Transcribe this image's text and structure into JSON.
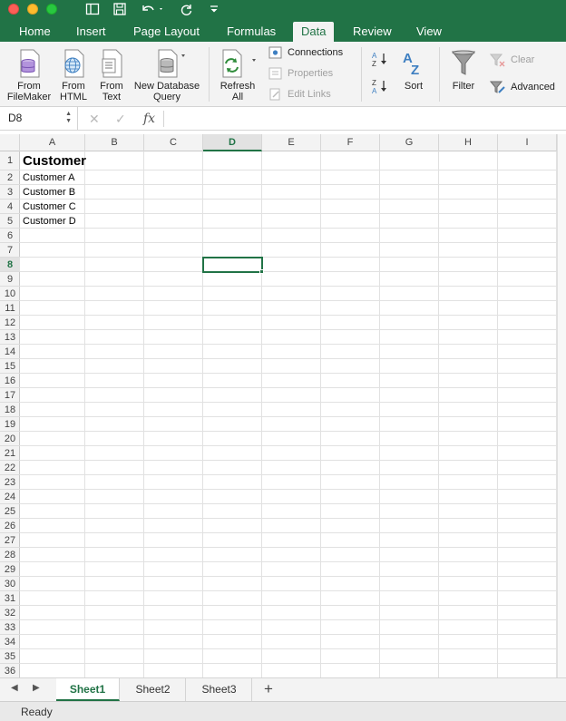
{
  "colors": {
    "brand": "#217346",
    "selection": "#217346"
  },
  "tabs": [
    {
      "label": "Home"
    },
    {
      "label": "Insert"
    },
    {
      "label": "Page Layout"
    },
    {
      "label": "Formulas"
    },
    {
      "label": "Data",
      "active": true
    },
    {
      "label": "Review"
    },
    {
      "label": "View"
    }
  ],
  "ribbon": {
    "from_filemaker": [
      "From",
      "FileMaker"
    ],
    "from_html": [
      "From",
      "HTML"
    ],
    "from_text": [
      "From",
      "Text"
    ],
    "new_db_query": [
      "New Database",
      "Query"
    ],
    "refresh_all": [
      "Refresh",
      "All"
    ],
    "connections": "Connections",
    "properties": "Properties",
    "edit_links": "Edit Links",
    "sort": "Sort",
    "filter": "Filter",
    "clear": "Clear",
    "advanced": "Advanced"
  },
  "formula_bar": {
    "name_box": "D8",
    "fx": "fx",
    "value": ""
  },
  "columns": [
    "A",
    "B",
    "C",
    "D",
    "E",
    "F",
    "G",
    "H",
    "I"
  ],
  "selected_column": "D",
  "selected_row": 8,
  "rows": [
    "1",
    "2",
    "3",
    "4",
    "5",
    "6",
    "7",
    "8",
    "9",
    "10",
    "11",
    "12",
    "13",
    "14",
    "15",
    "16",
    "17",
    "18",
    "19",
    "20",
    "21",
    "22",
    "23",
    "24",
    "25",
    "26",
    "27",
    "28",
    "29",
    "30",
    "31",
    "32",
    "33",
    "34",
    "35",
    "36"
  ],
  "cells": {
    "a1": "Customer",
    "a2": "Customer A",
    "a3": "Customer B",
    "a4": "Customer C",
    "a5": "Customer D"
  },
  "sheets": [
    {
      "label": "Sheet1",
      "active": true
    },
    {
      "label": "Sheet2"
    },
    {
      "label": "Sheet3"
    }
  ],
  "add_sheet": "+",
  "status": "Ready"
}
